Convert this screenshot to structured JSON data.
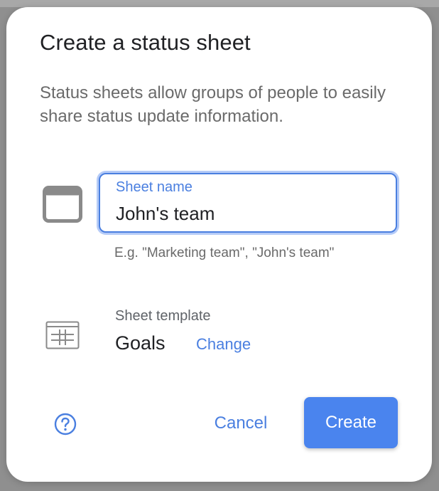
{
  "dialog": {
    "title": "Create a status sheet",
    "description": "Status sheets allow groups of people to easily share status update information."
  },
  "name_field": {
    "label": "Sheet name",
    "value": "John's team",
    "hint": "E.g. \"Marketing team\", \"John's team\"",
    "icon": "window-icon"
  },
  "template": {
    "label": "Sheet template",
    "value": "Goals",
    "change_label": "Change",
    "icon": "grid-icon"
  },
  "actions": {
    "help_icon": "help-icon",
    "cancel_label": "Cancel",
    "create_label": "Create"
  },
  "colors": {
    "accent": "#4a84ee",
    "link": "#4a7fe0",
    "text_primary": "#202124",
    "text_secondary": "#6a6a6a",
    "backdrop": "#8f8f8f"
  }
}
